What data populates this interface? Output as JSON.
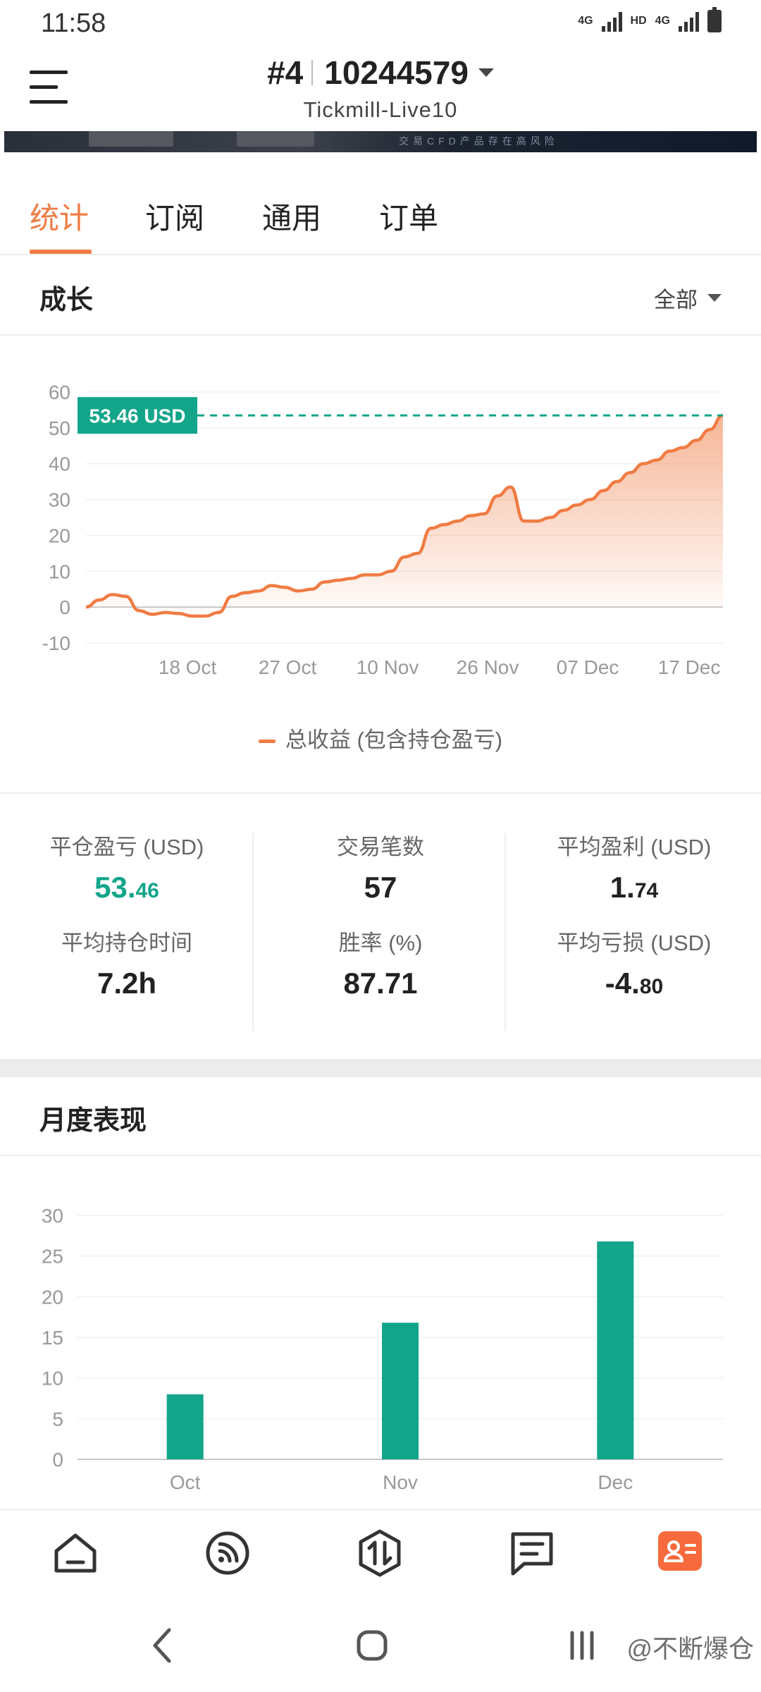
{
  "status_bar": {
    "time": "11:58",
    "net1": "4G",
    "net2": "HD",
    "net3": "4G"
  },
  "header": {
    "account_number": "#4",
    "account_id": "10244579",
    "server": "Tickmill-Live10"
  },
  "banner": {
    "disclaimer": "交易CFD产品存在高风险"
  },
  "tabs": [
    {
      "label": "统计"
    },
    {
      "label": "订阅"
    },
    {
      "label": "通用"
    },
    {
      "label": "订单"
    }
  ],
  "growth": {
    "title": "成长",
    "filter": "全部",
    "legend": "总收益 (包含持仓盈亏)",
    "current_label": "53.46 USD"
  },
  "stats": {
    "closed_pl_label": "平仓盈亏 (USD)",
    "closed_pl_int": "53.",
    "closed_pl_dec": "46",
    "trades_label": "交易笔数",
    "trades": "57",
    "avg_profit_label": "平均盈利 (USD)",
    "avg_profit_int": "1.",
    "avg_profit_dec": "74",
    "avg_hold_label": "平均持仓时间",
    "avg_hold": "7.2h",
    "win_rate_label": "胜率 (%)",
    "win_rate": "87.71",
    "avg_loss_label": "平均亏损 (USD)",
    "avg_loss_int": "-4.",
    "avg_loss_dec": "80"
  },
  "monthly": {
    "title": "月度表现"
  },
  "watermark": "@不断爆仓",
  "colors": {
    "accent": "#f07b43",
    "green": "#12a58a",
    "nav_active": "#f66a3d"
  },
  "chart_data": [
    {
      "type": "area",
      "x_ticks": [
        "18 Oct",
        "27 Oct",
        "10 Nov",
        "26 Nov",
        "07 Dec",
        "17 Dec"
      ],
      "ylim": [
        -10,
        60
      ],
      "y_ticks": [
        60,
        50,
        40,
        30,
        20,
        10,
        0,
        -10
      ],
      "series": [
        {
          "name": "总收益 (包含持仓盈亏)",
          "values": [
            0,
            2,
            3.5,
            3,
            -1,
            -2,
            -1.5,
            -1.8,
            -2.5,
            -2.5,
            -1.5,
            3,
            4,
            4.5,
            6,
            5.5,
            4.5,
            5,
            7,
            7.5,
            8,
            9,
            9,
            10,
            14,
            15,
            22,
            23,
            24,
            25.5,
            26,
            31,
            33.5,
            24,
            24,
            25,
            27,
            28.5,
            30,
            32.5,
            35,
            37.5,
            40,
            41,
            43.5,
            44.5,
            46.5,
            49.5,
            53.46
          ]
        }
      ],
      "grid": true,
      "reference_line": 53.46
    },
    {
      "type": "bar",
      "categories": [
        "Oct",
        "Nov",
        "Dec"
      ],
      "values": [
        8,
        16.8,
        26.8
      ],
      "ylim": [
        0,
        30
      ],
      "y_ticks": [
        30,
        25,
        20,
        15,
        10,
        5,
        0
      ],
      "grid": true
    }
  ]
}
